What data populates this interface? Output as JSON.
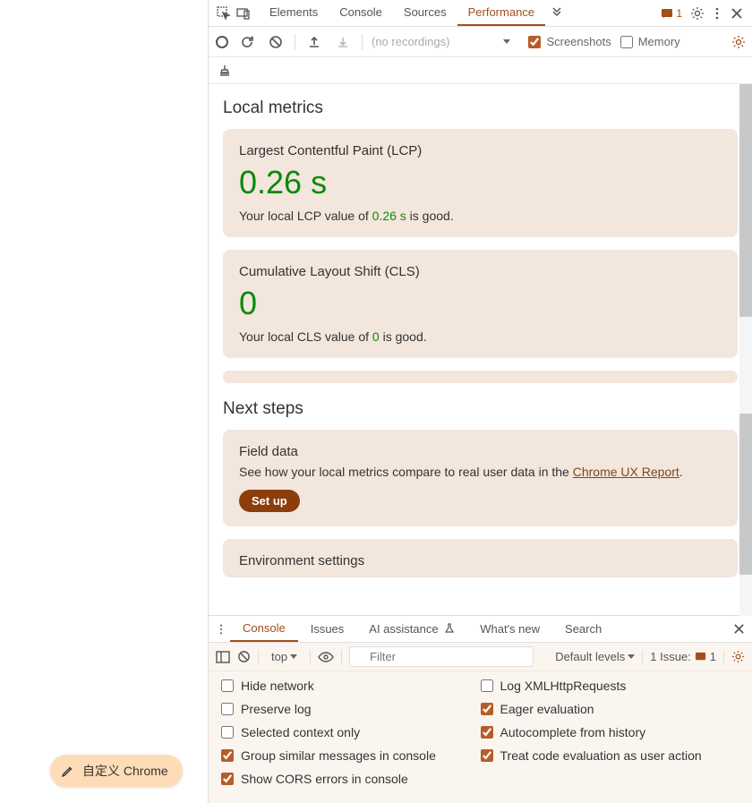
{
  "header": {
    "tabs": [
      "Elements",
      "Console",
      "Sources",
      "Performance"
    ],
    "active_tab": "Performance",
    "issue_count": "1"
  },
  "perf_toolbar": {
    "no_recordings": "(no recordings)",
    "screenshots_label": "Screenshots",
    "memory_label": "Memory"
  },
  "local_metrics": {
    "title": "Local metrics",
    "cards": [
      {
        "name": "Largest Contentful Paint (LCP)",
        "value": "0.26 s",
        "desc_pre": "Your local LCP value of ",
        "desc_val": "0.26 s",
        "desc_post": " is good."
      },
      {
        "name": "Cumulative Layout Shift (CLS)",
        "value": "0",
        "desc_pre": "Your local CLS value of ",
        "desc_val": "0",
        "desc_post": " is good."
      }
    ]
  },
  "next_steps": {
    "title": "Next steps",
    "field": {
      "title": "Field data",
      "desc_pre": "See how your local metrics compare to real user data in the ",
      "link": "Chrome UX Report",
      "desc_post": ".",
      "button": "Set up"
    },
    "env": {
      "title": "Environment settings"
    }
  },
  "drawer": {
    "tabs": [
      "Console",
      "Issues",
      "AI assistance",
      "What's new",
      "Search"
    ],
    "active": "Console"
  },
  "console_toolbar": {
    "context": "top",
    "filter_placeholder": "Filter",
    "levels": "Default levels",
    "issue_text": "1 Issue:",
    "issue_num": "1"
  },
  "console_settings": {
    "left": [
      {
        "label": "Hide network",
        "checked": false
      },
      {
        "label": "Preserve log",
        "checked": false
      },
      {
        "label": "Selected context only",
        "checked": false
      },
      {
        "label": "Group similar messages in console",
        "checked": true
      },
      {
        "label": "Show CORS errors in console",
        "checked": true
      }
    ],
    "right": [
      {
        "label": "Log XMLHttpRequests",
        "checked": false
      },
      {
        "label": "Eager evaluation",
        "checked": true
      },
      {
        "label": "Autocomplete from history",
        "checked": true
      },
      {
        "label": "Treat code evaluation as user action",
        "checked": true
      }
    ]
  },
  "customize_btn": "自定义 Chrome"
}
